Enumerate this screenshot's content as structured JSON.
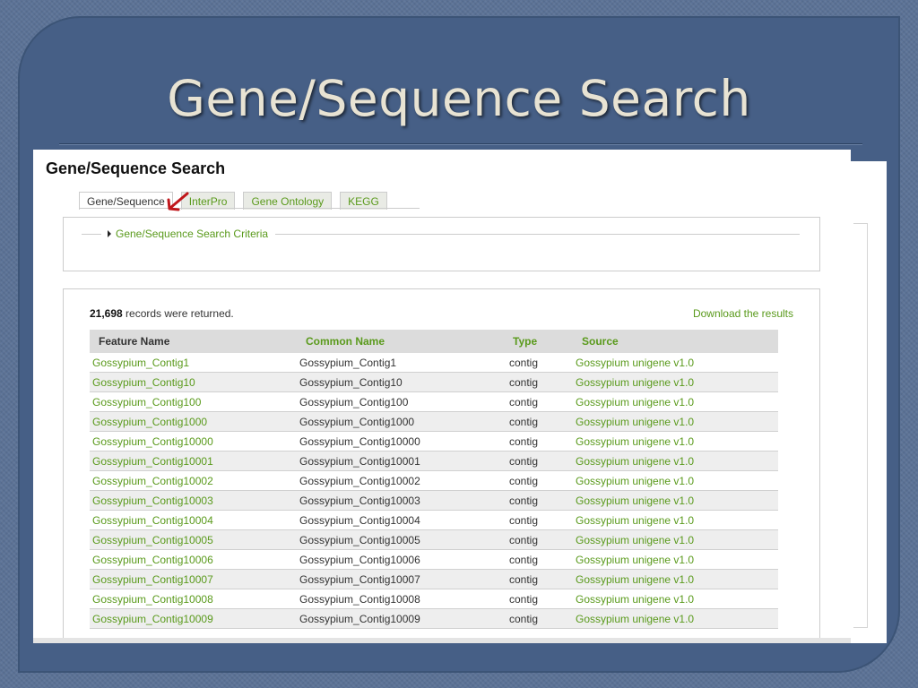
{
  "slide": {
    "title": "Gene/Sequence Search"
  },
  "page": {
    "heading": "Gene/Sequence Search"
  },
  "tabs": [
    {
      "label": "Gene/Sequence",
      "active": true
    },
    {
      "label": "InterPro",
      "active": false
    },
    {
      "label": "Gene Ontology",
      "active": false
    },
    {
      "label": "KEGG",
      "active": false
    }
  ],
  "criteria": {
    "label": "Gene/Sequence Search Criteria"
  },
  "results": {
    "count": "21,698",
    "count_suffix": " records were returned.",
    "download_label": "Download the results",
    "columns": [
      "Feature Name",
      "Common Name",
      "Type",
      "Source"
    ],
    "rows": [
      [
        "Gossypium_Contig1",
        "Gossypium_Contig1",
        "contig",
        "Gossypium unigene v1.0"
      ],
      [
        "Gossypium_Contig10",
        "Gossypium_Contig10",
        "contig",
        "Gossypium unigene v1.0"
      ],
      [
        "Gossypium_Contig100",
        "Gossypium_Contig100",
        "contig",
        "Gossypium unigene v1.0"
      ],
      [
        "Gossypium_Contig1000",
        "Gossypium_Contig1000",
        "contig",
        "Gossypium unigene v1.0"
      ],
      [
        "Gossypium_Contig10000",
        "Gossypium_Contig10000",
        "contig",
        "Gossypium unigene v1.0"
      ],
      [
        "Gossypium_Contig10001",
        "Gossypium_Contig10001",
        "contig",
        "Gossypium unigene v1.0"
      ],
      [
        "Gossypium_Contig10002",
        "Gossypium_Contig10002",
        "contig",
        "Gossypium unigene v1.0"
      ],
      [
        "Gossypium_Contig10003",
        "Gossypium_Contig10003",
        "contig",
        "Gossypium unigene v1.0"
      ],
      [
        "Gossypium_Contig10004",
        "Gossypium_Contig10004",
        "contig",
        "Gossypium unigene v1.0"
      ],
      [
        "Gossypium_Contig10005",
        "Gossypium_Contig10005",
        "contig",
        "Gossypium unigene v1.0"
      ],
      [
        "Gossypium_Contig10006",
        "Gossypium_Contig10006",
        "contig",
        "Gossypium unigene v1.0"
      ],
      [
        "Gossypium_Contig10007",
        "Gossypium_Contig10007",
        "contig",
        "Gossypium unigene v1.0"
      ],
      [
        "Gossypium_Contig10008",
        "Gossypium_Contig10008",
        "contig",
        "Gossypium unigene v1.0"
      ],
      [
        "Gossypium_Contig10009",
        "Gossypium_Contig10009",
        "contig",
        "Gossypium unigene v1.0"
      ]
    ]
  },
  "colors": {
    "link_green": "#5a9a1c",
    "slide_background": "#5b7296",
    "slide_panel": "#465f86",
    "annotation_arrow": "#c0161b"
  },
  "icons": {
    "criteria_toggle": "triangle-right-icon",
    "annotation": "red-arrow-icon"
  }
}
